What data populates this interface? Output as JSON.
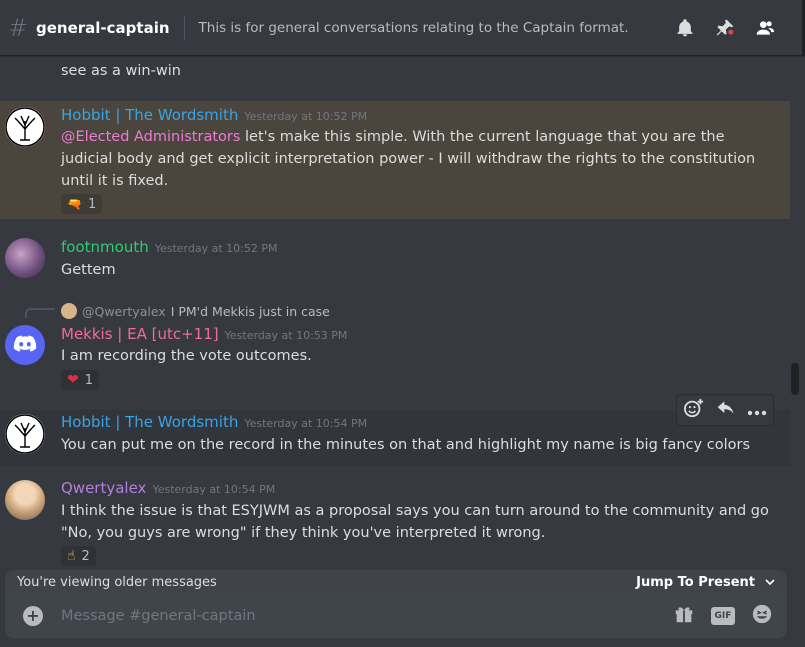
{
  "header": {
    "channel": "general-captain",
    "topic": "This is for general conversations relating to the Captain format."
  },
  "messages": [
    {
      "partial_text": "It was a good point, and now I have a magshot of the Virgin CEO in my memes folder, which I see as a win-win"
    },
    {
      "username": "Hobbit | The Wordsmith",
      "username_color": "#3ba3e3",
      "timestamp": "Yesterday at 10:52 PM",
      "mention": "@Elected Administrators",
      "text": " let's make this simple. With the current language that you are the judicial body and get explicit interpretation power - I will withdraw the rights to the constitution until it is fixed.",
      "reaction_emoji": "🔫",
      "reaction_count": "1"
    },
    {
      "username": "footnmouth",
      "username_color": "#2ecc71",
      "timestamp": "Yesterday at 10:52 PM",
      "text": "Gettem"
    },
    {
      "reply_to": "@Qwertyalex",
      "reply_text": "I PM'd Mekkis just in case",
      "username": "Mekkis | EA [utc+11]",
      "username_color": "#f06a9a",
      "timestamp": "Yesterday at 10:53 PM",
      "text": "I am recording the vote outcomes.",
      "reaction_emoji": "❤",
      "reaction_count": "1"
    },
    {
      "username": "Hobbit | The Wordsmith",
      "username_color": "#3ba3e3",
      "timestamp": "Yesterday at 10:54 PM",
      "text": "You can put me on the record in the minutes on that and highlight my name is big fancy colors"
    },
    {
      "username": "Qwertyalex",
      "username_color": "#b57edc",
      "timestamp": "Yesterday at 10:54 PM",
      "text": "I think the issue is that ESYJWM as a proposal says you can turn around to the community and go \"No, you guys are wrong\" if they think you've interpreted it wrong.",
      "reaction_emoji": "☝",
      "reaction_count": "2"
    }
  ],
  "older_bar": {
    "text": "You're viewing older messages",
    "jump": "Jump To Present"
  },
  "composer": {
    "placeholder": "Message #general-captain",
    "gif_label": "GIF"
  }
}
